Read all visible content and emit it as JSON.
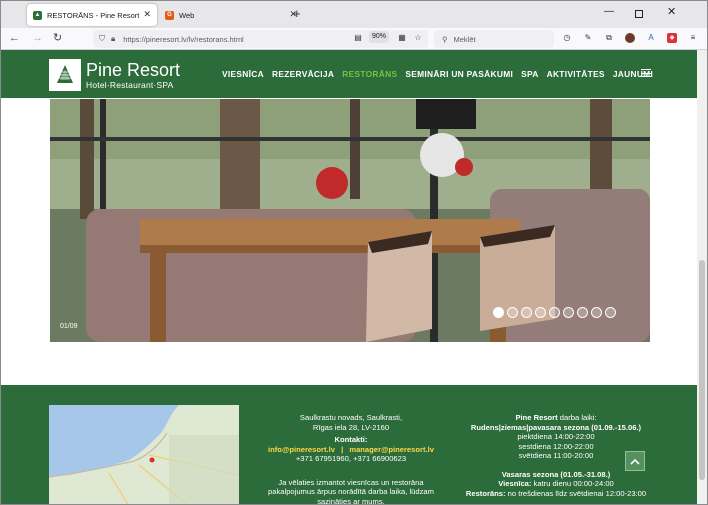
{
  "browser": {
    "tabs": [
      {
        "label": "RESTORĀNS - Pine Resort",
        "favicon": "pine-favicon-icon"
      },
      {
        "label": "Web",
        "favicon": "web-favicon-icon"
      }
    ],
    "url": "https://pineresort.lv/lv/restorans.html",
    "zoom": "90%",
    "search_placeholder": "Meklēt"
  },
  "site": {
    "logo": {
      "title": "Pine Resort",
      "subtitle": "Hotel·Restaurant·SPA"
    },
    "nav": [
      "VIESNĪCA",
      "REZERVĀCIJA",
      "RESTORĀNS",
      "SEMINĀRI UN PASĀKUMI",
      "SPA",
      "AKTIVITĀTES",
      "JAUNUMI"
    ],
    "active_nav": "RESTORĀNS",
    "colors": {
      "brand_green": "#2c6b3a",
      "accent_green": "#79c043",
      "email_yellow": "#ffd84a"
    }
  },
  "hero": {
    "counter": "01/09",
    "slides_total": 9,
    "current_slide": 1
  },
  "footer": {
    "address_line1": "Saulkrastu novads, Saulkrasti,",
    "address_line2": "Rīgas iela 28, LV-2160",
    "contacts_label": "Kontakti:",
    "email1": "info@pineresort.lv",
    "separator": "|",
    "email2": "manager@pineresort.lv",
    "phones": "+371 67951960, +371 66900623",
    "note_line1": "Ja vēlaties izmantot viesnīcas un restorāna",
    "note_line2": "pakalpojumus ārpus norādītā darba laika, lūdzam",
    "note_line3": "sazināties ar mums.",
    "hours_title_bold": "Pine Resort",
    "hours_title_rest": " darba laiki:",
    "season1_title": "Rudens|ziemas|pavasara sezona (01.09.-15.06.)",
    "season1_lines": [
      "piektdiena 14:00-22:00",
      "sestdiena 12:00-22:00",
      "svētdiena 11:00-20:00"
    ],
    "season2_title": "Vasaras sezona (01.05.-31.08.)",
    "season2_hotel_label": "Viesnīca:",
    "season2_hotel_value": " katru dienu 00:00-24:00",
    "season2_rest_label": "Restorāns:",
    "season2_rest_value": " no trešdienas līdz svētdienai 12:00-23:00"
  }
}
